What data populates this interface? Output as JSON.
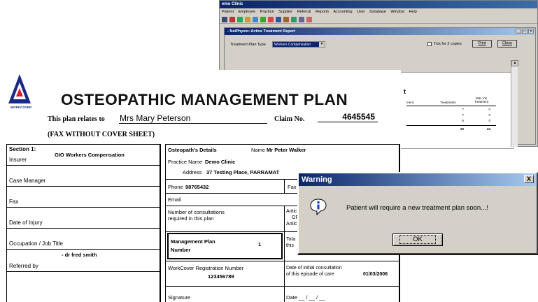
{
  "app": {
    "title": "emo Clinic",
    "menu": [
      "Patient",
      "Employee",
      "Practice",
      "Supplier",
      "Referral",
      "Reports",
      "Accounting",
      "User",
      "Database",
      "Window",
      "Help"
    ],
    "child": {
      "title": "- NetPhysio: Active Treatment Report",
      "controls": [
        "_",
        "□",
        "×"
      ],
      "type_label": "Treatment Plan Type",
      "type_value": "Workers Compensation",
      "copies_label": "Tick for 2 copies",
      "print_label": "Print",
      "close_label": "Close"
    }
  },
  "report": {
    "heading": "t",
    "col_headers": [
      "ment",
      "Treatments",
      "Max Vis Treatment"
    ],
    "rows": [
      [
        "7",
        "0"
      ],
      [
        "7",
        "0"
      ],
      [
        "6",
        "0"
      ]
    ],
    "totals": [
      "20",
      "24"
    ]
  },
  "form": {
    "logo_text": "WORKCOVER",
    "title": "OSTEOPATHIC MANAGEMENT PLAN",
    "plan_label": "This plan relates to",
    "patient_name": "Mrs Mary Peterson",
    "claim_label": "Claim No.",
    "claim_no": "4645545",
    "fax_note": "(FAX WITHOUT COVER SHEET)",
    "section1": {
      "heading": "Section 1:",
      "insurer_value": "GIO Workers Compensation",
      "insurer_label": "Insurer",
      "case_manager_label": "Case Manager",
      "fax_label": "Fax",
      "doi_label": "Date of Injury",
      "occupation_label": "Occupation / Job Title",
      "referred_value": "- dr fred smith",
      "referred_label": "Referred by"
    },
    "osteo": {
      "details_label": "Osteopath's Details",
      "name_label": "Name",
      "name_value": "Mr Peter Walker",
      "practice_label": "Practice Name",
      "practice_value": "Demo Clinic",
      "address_label": "Address",
      "address_value": "37 Testing Place, PARRAMAT",
      "phone_label": "Phone",
      "phone_value": "98765432",
      "fax_label": "Fax",
      "email_label": "Email",
      "consult_label_1": "Number of consultations",
      "consult_label_2": "required in this plan",
      "antic_1": "Antic",
      "antic_2": "OF",
      "antic_3": "Antic",
      "mp_label_1": "Management Plan",
      "mp_label_2": "Number",
      "mp_value": "1",
      "tota_1": "Tota",
      "tota_2": "this",
      "wc_reg_label": "WorkCover Registration Number",
      "wc_reg_value": "123456789",
      "initial_label_1": "Date of initial consultation",
      "initial_label_2": "of this episode of care",
      "initial_value": "01/03/2006",
      "signature_label": "Signature",
      "date_label": "Date __ / __ / __"
    }
  },
  "dialog": {
    "title": "Warning",
    "close": "X",
    "message": "Patient will require a new treatment plan soon...!",
    "ok_label": "OK"
  }
}
